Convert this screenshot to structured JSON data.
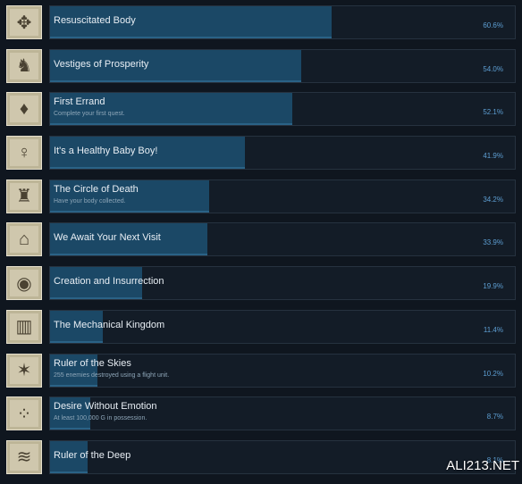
{
  "achievements": [
    {
      "name": "Resuscitated Body",
      "desc": "",
      "percent": "60.6%",
      "value": 60.6,
      "icon": "winged-figure-icon"
    },
    {
      "name": "Vestiges of Prosperity",
      "desc": "",
      "percent": "54.0%",
      "value": 54.0,
      "icon": "antlered-creature-icon"
    },
    {
      "name": "First Errand",
      "desc": "Complete your first quest.",
      "percent": "52.1%",
      "value": 52.1,
      "icon": "emblem-icon"
    },
    {
      "name": "It's a Healthy Baby Boy!",
      "desc": "",
      "percent": "41.9%",
      "value": 41.9,
      "icon": "android-figure-icon"
    },
    {
      "name": "The Circle of Death",
      "desc": "Have your body collected.",
      "percent": "34.2%",
      "value": 34.2,
      "icon": "machine-figure-icon"
    },
    {
      "name": "We Await Your Next Visit",
      "desc": "",
      "percent": "33.9%",
      "value": 33.9,
      "icon": "ruins-icon"
    },
    {
      "name": "Creation and Insurrection",
      "desc": "",
      "percent": "19.9%",
      "value": 19.9,
      "icon": "sphere-icon"
    },
    {
      "name": "The Mechanical Kingdom",
      "desc": "",
      "percent": "11.4%",
      "value": 11.4,
      "icon": "tower-icon"
    },
    {
      "name": "Ruler of the Skies",
      "desc": "255 enemies destroyed using a flight unit.",
      "percent": "10.2%",
      "value": 10.2,
      "icon": "flight-unit-icon"
    },
    {
      "name": "Desire Without Emotion",
      "desc": "At least 100,000 G in possession.",
      "percent": "8.7%",
      "value": 8.7,
      "icon": "coins-icon"
    },
    {
      "name": "Ruler of the Deep",
      "desc": "",
      "percent": "8.1%",
      "value": 8.1,
      "icon": "wave-icon"
    }
  ],
  "watermark": "ALI213.NET",
  "colors": {
    "bar": "#1b4866",
    "percent_text": "#5d9ed2",
    "background": "#0f161f"
  }
}
